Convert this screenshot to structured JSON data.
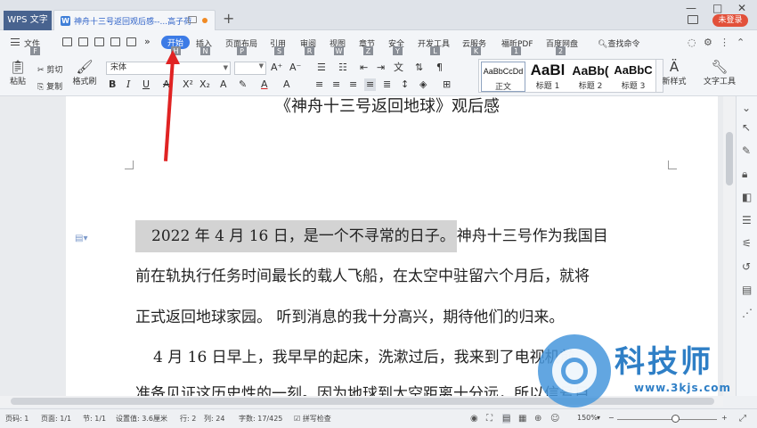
{
  "titlebar": {
    "app_name": "WPS 文字",
    "doc_tab_title": "神舟十三号返回观后感--...高子荷",
    "login_label": "未登录",
    "minimize": "—",
    "maximize": "□",
    "close": "✕"
  },
  "menubar": {
    "file_label": "文件",
    "items": [
      {
        "label": "开始",
        "key": "H"
      },
      {
        "label": "插入",
        "key": "N"
      },
      {
        "label": "页面布局",
        "key": "P"
      },
      {
        "label": "引用",
        "key": "S"
      },
      {
        "label": "审阅",
        "key": "R"
      },
      {
        "label": "视图",
        "key": "W"
      },
      {
        "label": "章节",
        "key": "Z"
      },
      {
        "label": "安全",
        "key": "Y"
      },
      {
        "label": "开发工具",
        "key": "L"
      },
      {
        "label": "云服务",
        "key": "K"
      },
      {
        "label": "福昕PDF",
        "key": "1"
      },
      {
        "label": "百度网盘",
        "key": "2"
      }
    ],
    "file_key": "F",
    "search_label": "查找命令"
  },
  "ribbon": {
    "paste_label": "粘贴",
    "cut_label": "剪切",
    "copy_label": "复制",
    "format_painter_label": "格式刷",
    "font_name": "宋体",
    "font_size": "",
    "styles": [
      {
        "sample": "AaBbCcDd",
        "name": "正文"
      },
      {
        "sample": "AaBl",
        "name": "标题 1"
      },
      {
        "sample": "AaBb(",
        "name": "标题 2"
      },
      {
        "sample": "AaBbC",
        "name": "标题 3"
      }
    ],
    "new_style_label": "新样式",
    "text_tools_label": "文字工具"
  },
  "document": {
    "title": "《神舟十三号返回地球》观后感",
    "line1_hl": "2022 年 4 月 16 日，是一个不寻常的日子。",
    "line1_rest": "神舟十三号作为我国目",
    "line2": "前在轨执行任务时间最长的载人飞船，在太空中驻留六个月后，就将",
    "line3": "正式返回地球家园。 听到消息的我十分高兴，期待他们的归来。",
    "line4": "4 月 16 日早上，我早早的起床，洗漱过后，我来到了电视机前，",
    "line5": "准备见证这历史性的一刻。因为地球到太空距离十分远，所以信号目"
  },
  "statusbar": {
    "page_code": "页码: 1",
    "pages": "页面: 1/1",
    "section": "节: 1/1",
    "setting": "设置值: 3.6厘米",
    "row": "行: 2",
    "col": "列: 24",
    "words": "字数: 17/425",
    "spellcheck": "拼写检查",
    "zoom": "150%"
  },
  "watermark": {
    "name": "科技师",
    "url": "www.3kjs.com"
  },
  "colors": {
    "accent": "#3c7be6",
    "arrow": "#e02323",
    "login": "#e2503a"
  }
}
